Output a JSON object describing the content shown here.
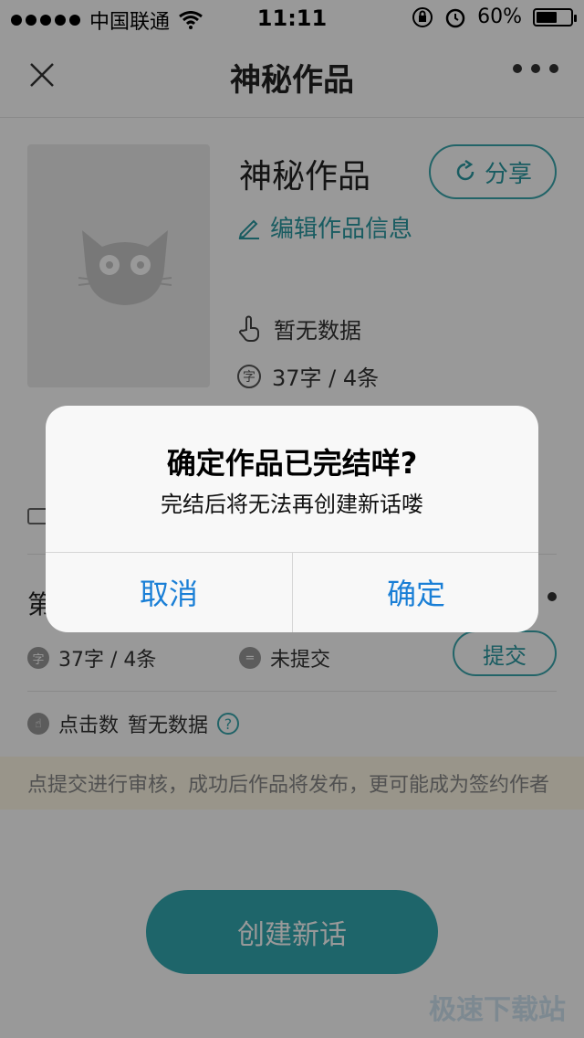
{
  "status_bar": {
    "carrier": "中国联通",
    "time": "11:11",
    "battery_percent": "60%",
    "battery_level": 0.6
  },
  "nav": {
    "title": "神秘作品",
    "close_icon": "close-icon",
    "more_icon": "more-icon"
  },
  "work": {
    "title": "神秘作品",
    "share_label": "分享",
    "edit_label": "编辑作品信息",
    "views": "暂无数据",
    "word_count": "37字 / 4条",
    "cover_icon": "cat-icon"
  },
  "chapter": {
    "label": "第",
    "word_count": "37字 / 4条",
    "status": "未提交",
    "submit_label": "提交",
    "clicks_label": "点击数",
    "clicks_value": "暂无数据"
  },
  "notice": "点提交进行审核，成功后作品将发布，更可能成为签约作者",
  "create_button": "创建新话",
  "watermark": "极速下载站",
  "dialog": {
    "title": "确定作品已完结咩?",
    "message": "完结后将无法再创建新话喽",
    "cancel_label": "取消",
    "confirm_label": "确定"
  },
  "colors": {
    "accent": "#33a9b1",
    "dialog_button": "#1a7fd6"
  }
}
